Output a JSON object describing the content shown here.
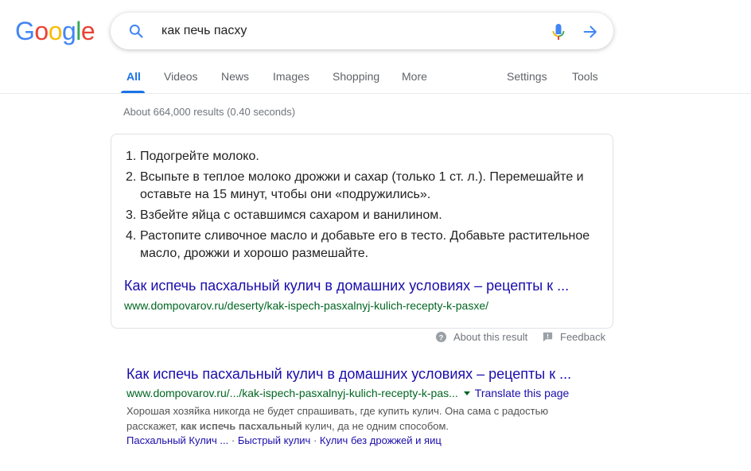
{
  "logo": {
    "letters": [
      "G",
      "o",
      "o",
      "g",
      "l",
      "e"
    ],
    "colors": [
      "#4285F4",
      "#EA4335",
      "#FBBC05",
      "#4285F4",
      "#34A853",
      "#EA4335"
    ]
  },
  "search": {
    "query": "как печь пасху",
    "icons": [
      "search-icon",
      "mic-icon",
      "arrow-right-icon"
    ]
  },
  "tabs": {
    "all": "All",
    "videos": "Videos",
    "news": "News",
    "images": "Images",
    "shopping": "Shopping",
    "more": "More",
    "settings": "Settings",
    "tools": "Tools"
  },
  "result_stats": "About 664,000 results (0.40 seconds)",
  "snippet": {
    "steps": [
      {
        "num": "1.",
        "text": "Подогрейте молоко."
      },
      {
        "num": "2.",
        "text": "Всыпьте в теплое молоко дрожжи и сахар (только 1 ст. л.). Перемешайте и оставьте на 15 минут, чтобы они «подружились»."
      },
      {
        "num": "3.",
        "text": "Взбейте яйца с оставшимся сахаром и ванилином."
      },
      {
        "num": "4.",
        "text": "Растопите сливочное масло и добавьте его в тесто. Добавьте растительное масло, дрожжи и хорошо размешайте."
      }
    ],
    "link_title": "Как испечь пасхальный кулич в домашних условиях – рецепты к ...",
    "url": "www.dompovarov.ru/deserty/kak-ispech-pasxalnyj-kulich-recepty-k-pasxe/",
    "about_label": "About this result",
    "feedback_label": "Feedback"
  },
  "result": {
    "title": "Как испечь пасхальный кулич в домашних условиях – рецепты к ...",
    "url": "www.dompovarov.ru/.../kak-ispech-pasxalnyj-kulich-recepty-k-pas...",
    "translate": "Translate this page",
    "desc_1": "Хорошая хозяйка никогда не будет спрашивать, где купить кулич. Она сама с радостью расскажет, ",
    "desc_bold": "как испечь пасхальный",
    "desc_2": " кулич, да не одним способом.",
    "sitelinks": [
      "Пасхальный Кулич ...",
      "Быстрый кулич",
      "Кулич без дрожжей и яиц"
    ],
    "separator": "·"
  }
}
